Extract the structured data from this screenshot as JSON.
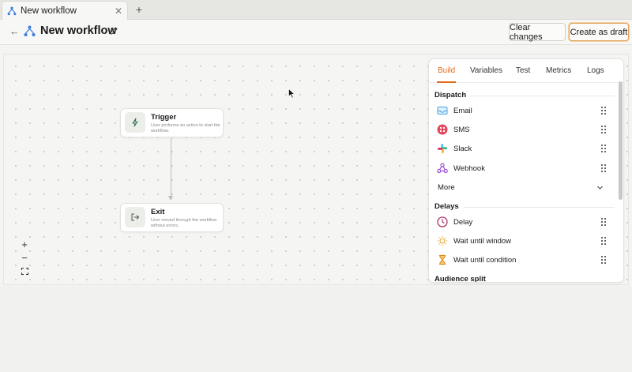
{
  "browser": {
    "tab_title": "New workflow",
    "close_glyph": "✕",
    "new_tab_glyph": "+"
  },
  "header": {
    "back_glyph": "←",
    "title": "New workflow",
    "clear_label": "Clear changes",
    "draft_label": "Create as draft"
  },
  "canvas": {
    "nodes": [
      {
        "title": "Trigger",
        "description": "User performs an action to start the workflow.",
        "icon": "lightning-icon"
      },
      {
        "title": "Exit",
        "description": "User moved through the workflow without errors.",
        "icon": "exit-icon"
      }
    ],
    "zoom_controls": [
      "+",
      "−",
      "⛶"
    ]
  },
  "panel": {
    "tabs": [
      "Build",
      "Variables",
      "Test",
      "Metrics",
      "Logs"
    ],
    "active_tab": "Build",
    "sections": [
      {
        "title": "Dispatch",
        "items": [
          {
            "label": "Email",
            "icon": "email-icon"
          },
          {
            "label": "SMS",
            "icon": "sms-icon"
          },
          {
            "label": "Slack",
            "icon": "slack-icon"
          },
          {
            "label": "Webhook",
            "icon": "webhook-icon"
          }
        ],
        "more_label": "More"
      },
      {
        "title": "Delays",
        "items": [
          {
            "label": "Delay",
            "icon": "clock-icon"
          },
          {
            "label": "Wait until window",
            "icon": "sun-icon"
          },
          {
            "label": "Wait until condition",
            "icon": "hourglass-icon"
          }
        ]
      },
      {
        "title": "Audience split"
      }
    ]
  },
  "colors": {
    "accent": "#e06a1a",
    "draft_border": "#e0a05a",
    "workflow_icon": "#3b7de0"
  }
}
